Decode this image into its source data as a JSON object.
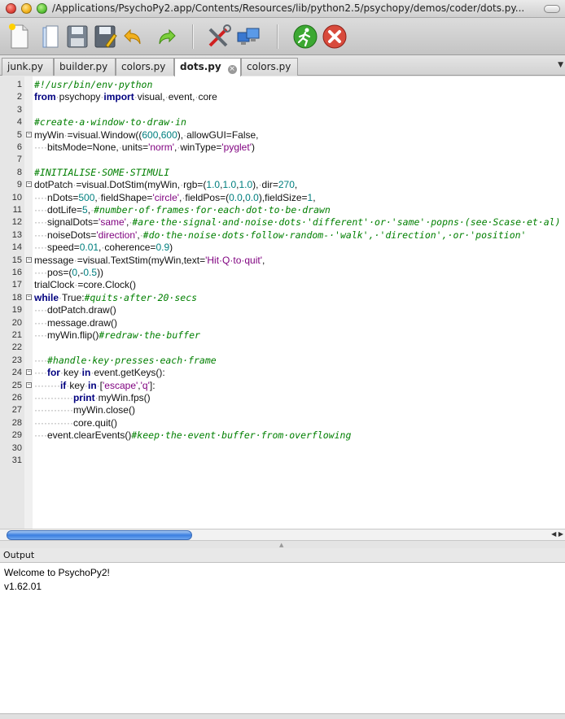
{
  "window": {
    "title": "/Applications/PsychoPy2.app/Contents/Resources/lib/python2.5/psychopy/demos/coder/dots.py..."
  },
  "toolbar": {
    "buttons": [
      {
        "name": "new-file",
        "icon": "new-document-icon"
      },
      {
        "name": "open-file",
        "icon": "open-folder-icon"
      },
      {
        "name": "save",
        "icon": "floppy-disk-icon"
      },
      {
        "name": "save-as",
        "icon": "save-as-icon"
      },
      {
        "name": "undo",
        "icon": "undo-arrow-icon"
      },
      {
        "name": "redo",
        "icon": "redo-arrow-icon"
      },
      {
        "name": "preferences",
        "icon": "tools-icon"
      },
      {
        "name": "monitor-center",
        "icon": "monitors-icon"
      },
      {
        "name": "run",
        "icon": "run-man-icon"
      },
      {
        "name": "stop",
        "icon": "stop-x-icon"
      }
    ]
  },
  "tabs": [
    {
      "label": "junk.py",
      "active": false
    },
    {
      "label": "builder.py",
      "active": false
    },
    {
      "label": "colors.py",
      "active": false
    },
    {
      "label": "dots.py",
      "active": true
    },
    {
      "label": "colors.py",
      "active": false
    }
  ],
  "code_lines": [
    {
      "n": "1",
      "html": "<span class='cm'>#!/usr/bin/env·python</span>"
    },
    {
      "n": "2",
      "html": "<span class='kw'>from</span><span class='ws'>·</span>psychopy<span class='ws'>·</span><span class='kw'>import</span><span class='ws'>·</span>visual,<span class='ws'>·</span>event,<span class='ws'>·</span>core"
    },
    {
      "n": "3",
      "html": ""
    },
    {
      "n": "4",
      "html": "<span class='cm'>#create·a·window·to·draw·in</span>"
    },
    {
      "n": "5",
      "html": "myWin<span class='ws'>·</span>=visual.Window((<span class='nm'>600</span>,<span class='nm'>600</span>),<span class='ws'>·</span>allowGUI=False,",
      "fold": "open"
    },
    {
      "n": "6",
      "html": "<span class='ws'>····</span>bitsMode=None,<span class='ws'>·</span>units=<span class='st'>'norm'</span>,<span class='ws'>·</span>winType=<span class='st'>'pyglet'</span>)"
    },
    {
      "n": "7",
      "html": ""
    },
    {
      "n": "8",
      "html": "<span class='cm'>#INITIALISE·SOME·STIMULI</span>"
    },
    {
      "n": "9",
      "html": "dotPatch<span class='ws'>·</span>=visual.DotStim(myWin,<span class='ws'>·</span>rgb=(<span class='nm'>1.0</span>,<span class='nm'>1.0</span>,<span class='nm'>1.0</span>),<span class='ws'>·</span>dir=<span class='nm'>270</span>,",
      "fold": "open"
    },
    {
      "n": "10",
      "html": "<span class='ws'>····</span>nDots=<span class='nm'>500</span>,<span class='ws'>·</span>fieldShape=<span class='st'>'circle'</span>,<span class='ws'>·</span>fieldPos=(<span class='nm'>0.0</span>,<span class='nm'>0.0</span>),fieldSize=<span class='nm'>1</span>,"
    },
    {
      "n": "11",
      "html": "<span class='ws'>····</span>dotLife=<span class='nm'>5</span>,<span class='ws'>·</span><span class='cm'>#number·of·frames·for·each·dot·to·be·drawn</span>"
    },
    {
      "n": "12",
      "html": "<span class='ws'>····</span>signalDots=<span class='st'>'same'</span>,<span class='ws'>·</span><span class='cm'>#are·the·signal·and·noise·dots·'different'·or·'same'·popns·(see·Scase·et·al)</span>"
    },
    {
      "n": "13",
      "html": "<span class='ws'>····</span>noiseDots=<span class='st'>'direction'</span>,<span class='ws'>·</span><span class='cm'>#do·the·noise·dots·follow·random-·'walk',·'direction',·or·'position'</span>"
    },
    {
      "n": "14",
      "html": "<span class='ws'>····</span>speed=<span class='nm'>0.01</span>,<span class='ws'>·</span>coherence=<span class='nm'>0.9</span>)"
    },
    {
      "n": "15",
      "html": "message<span class='ws'>·</span>=visual.TextStim(myWin,text=<span class='st'>'Hit·Q·to·quit'</span>,",
      "fold": "open"
    },
    {
      "n": "16",
      "html": "<span class='ws'>····</span>pos=(<span class='nm'>0</span>,-<span class='nm'>0.5</span>))"
    },
    {
      "n": "17",
      "html": "trialClock<span class='ws'>·</span>=core.Clock()"
    },
    {
      "n": "18",
      "html": "<span class='kw'>while</span><span class='ws'>·</span>True:<span class='cm'>#quits·after·20·secs</span>",
      "fold": "open"
    },
    {
      "n": "19",
      "html": "<span class='ws'>····</span>dotPatch.draw()"
    },
    {
      "n": "20",
      "html": "<span class='ws'>····</span>message.draw()"
    },
    {
      "n": "21",
      "html": "<span class='ws'>····</span>myWin.flip()<span class='cm'>#redraw·the·buffer</span>"
    },
    {
      "n": "22",
      "html": ""
    },
    {
      "n": "23",
      "html": "<span class='ws'>····</span><span class='cm'>#handle·key·presses·each·frame</span>"
    },
    {
      "n": "24",
      "html": "<span class='ws'>····</span><span class='kw'>for</span><span class='ws'>·</span>key<span class='ws'>·</span><span class='kw'>in</span><span class='ws'>·</span>event.getKeys():",
      "fold": "open"
    },
    {
      "n": "25",
      "html": "<span class='ws'>········</span><span class='kw'>if</span><span class='ws'>·</span>key<span class='ws'>·</span><span class='kw'>in</span><span class='ws'>·</span>[<span class='st'>'escape'</span>,<span class='st'>'q'</span>]:",
      "fold": "open"
    },
    {
      "n": "26",
      "html": "<span class='ws'>············</span><span class='kw'>print</span><span class='ws'>·</span>myWin.fps()"
    },
    {
      "n": "27",
      "html": "<span class='ws'>············</span>myWin.close()"
    },
    {
      "n": "28",
      "html": "<span class='ws'>············</span>core.quit()"
    },
    {
      "n": "29",
      "html": "<span class='ws'>····</span>event.clearEvents()<span class='cm'>#keep·the·event·buffer·from·overflowing</span>"
    },
    {
      "n": "30",
      "html": ""
    },
    {
      "n": "31",
      "html": ""
    }
  ],
  "output": {
    "header": "Output",
    "lines": [
      "Welcome to PsychoPy2!",
      "v1.62.01"
    ]
  },
  "colors": {
    "keyword": "#00007f",
    "comment": "#007f00",
    "string": "#7f007f",
    "number": "#007f7f",
    "scroll_thumb": "#3b7ee0"
  }
}
